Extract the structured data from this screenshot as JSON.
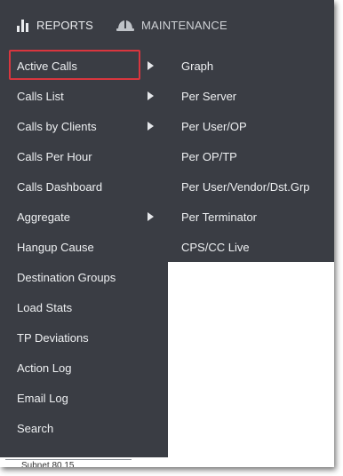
{
  "topnav": {
    "reports": {
      "label": "REPORTS",
      "icon": "bar-chart-icon"
    },
    "maintenance": {
      "label": "MAINTENANCE",
      "icon": "helmet-icon"
    }
  },
  "menu": {
    "items": [
      {
        "label": "Active Calls",
        "has_submenu": true,
        "highlighted": true
      },
      {
        "label": "Calls List",
        "has_submenu": true
      },
      {
        "label": "Calls by Clients",
        "has_submenu": true
      },
      {
        "label": "Calls Per Hour",
        "has_submenu": false
      },
      {
        "label": "Calls Dashboard",
        "has_submenu": false
      },
      {
        "label": "Aggregate",
        "has_submenu": true
      },
      {
        "label": "Hangup Cause",
        "has_submenu": false
      },
      {
        "label": "Destination Groups",
        "has_submenu": false
      },
      {
        "label": "Load Stats",
        "has_submenu": false
      },
      {
        "label": "TP Deviations",
        "has_submenu": false
      },
      {
        "label": "Action Log",
        "has_submenu": false
      },
      {
        "label": "Email Log",
        "has_submenu": false
      },
      {
        "label": "Search",
        "has_submenu": false
      }
    ]
  },
  "submenu": {
    "items": [
      {
        "label": "Graph"
      },
      {
        "label": "Per Server"
      },
      {
        "label": "Per User/OP"
      },
      {
        "label": "Per OP/TP"
      },
      {
        "label": "Per User/Vendor/Dst.Grp"
      },
      {
        "label": "Per Terminator"
      },
      {
        "label": "CPS/CC Live"
      }
    ]
  },
  "partial_text": "Subnet 80.15",
  "colors": {
    "menu_bg": "#3a3d44",
    "menu_text": "#eef0f2",
    "highlight_border": "#d9363e"
  }
}
